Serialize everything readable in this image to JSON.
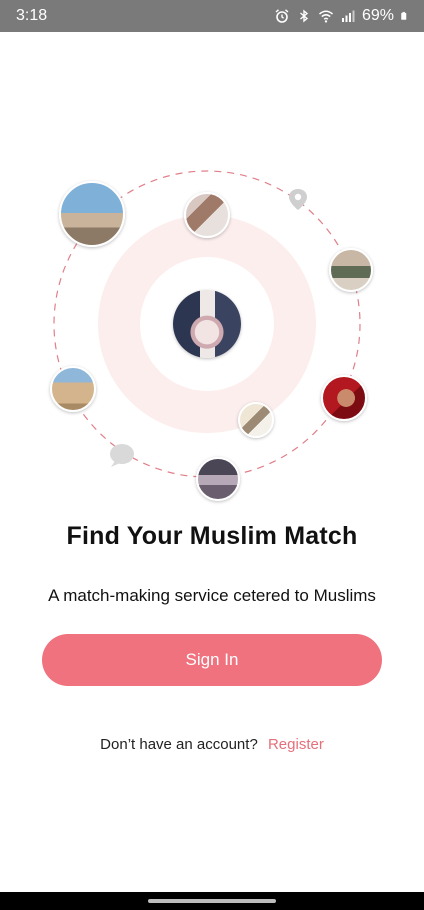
{
  "status_bar": {
    "time": "3:18",
    "battery": "69%",
    "icons": [
      "alarm-icon",
      "bluetooth-icon",
      "wifi-icon",
      "signal-icon",
      "battery-icon"
    ]
  },
  "hero": {
    "accent_ring_color": "#fdeeee",
    "dashed_orbit_color": "#e07f8a",
    "center_photo": "bride-bouquet-photo",
    "orbit_icons": [
      "location-pin-icon",
      "chat-bubble-icon"
    ]
  },
  "welcome": {
    "title": "Find Your Muslim Match",
    "subtitle": "A match-making service cetered to Muslims"
  },
  "actions": {
    "sign_in_label": "Sign In",
    "no_account_text": "Don’t have an account?",
    "register_label": "Register"
  },
  "colors": {
    "primary": "#f0727e",
    "link": "#e56f7b"
  }
}
